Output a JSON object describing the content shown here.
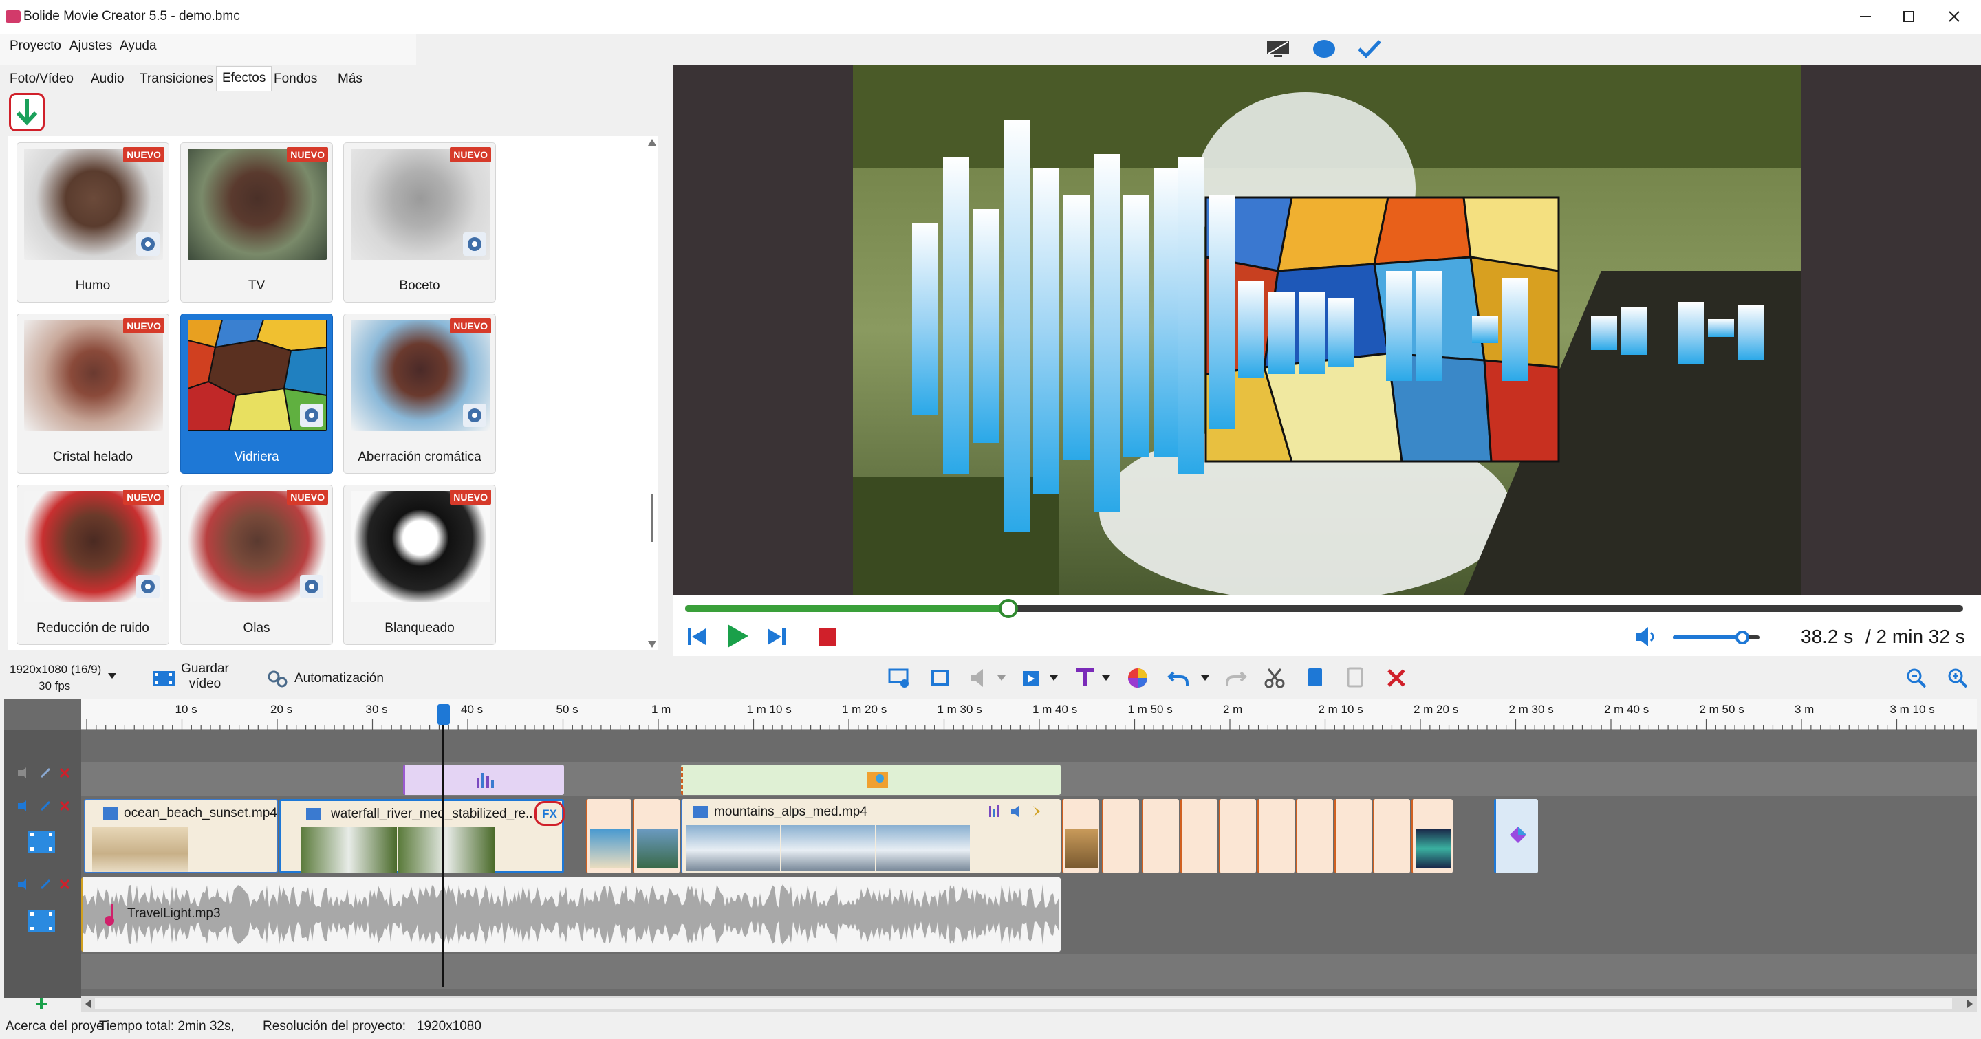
{
  "window": {
    "title": "Bolide Movie Creator 5.5 - demo.bmc"
  },
  "menu": [
    "Proyecto",
    "Ajustes",
    "Ayuda"
  ],
  "tabs": [
    "Foto/Vídeo",
    "Audio",
    "Transiciones",
    "Efectos",
    "Fondos",
    "Más"
  ],
  "active_tab": "Efectos",
  "effects": [
    {
      "name": "Humo",
      "badge": "NUEVO",
      "selected": false
    },
    {
      "name": "TV",
      "badge": "NUEVO",
      "selected": false
    },
    {
      "name": "Boceto",
      "badge": "NUEVO",
      "selected": false
    },
    {
      "name": "Cristal helado",
      "badge": "NUEVO",
      "selected": false
    },
    {
      "name": "Vidriera",
      "badge": "",
      "selected": true
    },
    {
      "name": "Aberración cromática",
      "badge": "NUEVO",
      "selected": false
    },
    {
      "name": "Reducción de ruido",
      "badge": "NUEVO",
      "selected": false
    },
    {
      "name": "Olas",
      "badge": "NUEVO",
      "selected": false
    },
    {
      "name": "Blanqueado",
      "badge": "NUEVO",
      "selected": false
    }
  ],
  "player": {
    "current_time": "38.2 s",
    "total_time": "/ 2 min 32 s",
    "progress": 0.253,
    "volume": 0.8
  },
  "toolbar": {
    "resolution": "1920x1080 (16/9)",
    "fps": "30 fps",
    "save_video_line1": "Guardar",
    "save_video_line2": "vídeo",
    "automation": "Automatización"
  },
  "ruler_labels": [
    "10 s",
    "20 s",
    "30 s",
    "40 s",
    "50 s",
    "1 m",
    "1 m 10 s",
    "1 m 20 s",
    "1 m 30 s",
    "1 m 40 s",
    "1 m 50 s",
    "2 m",
    "2 m 10 s",
    "2 m 20 s",
    "2 m 30 s",
    "2 m 40 s",
    "2 m 50 s",
    "3 m",
    "3 m 10 s"
  ],
  "clips": {
    "clip1": "ocean_beach_sunset.mp4",
    "clip2": "waterfall_river_med_stabilized_re...",
    "clip2_fx": "FX",
    "clip3": "mountains_alps_med.mp4",
    "audio": "TravelLight.mp3"
  },
  "status": {
    "about": "Acerca del proye",
    "total_time": "Tiempo total: 2min 32s,",
    "resolution": "Resolución del proyecto:   1920x1080"
  },
  "colors": {
    "accent": "#1e78d6",
    "badge": "#d63a2a",
    "progress": "#3aa03a",
    "audio_wave": "#9a9a9a"
  }
}
